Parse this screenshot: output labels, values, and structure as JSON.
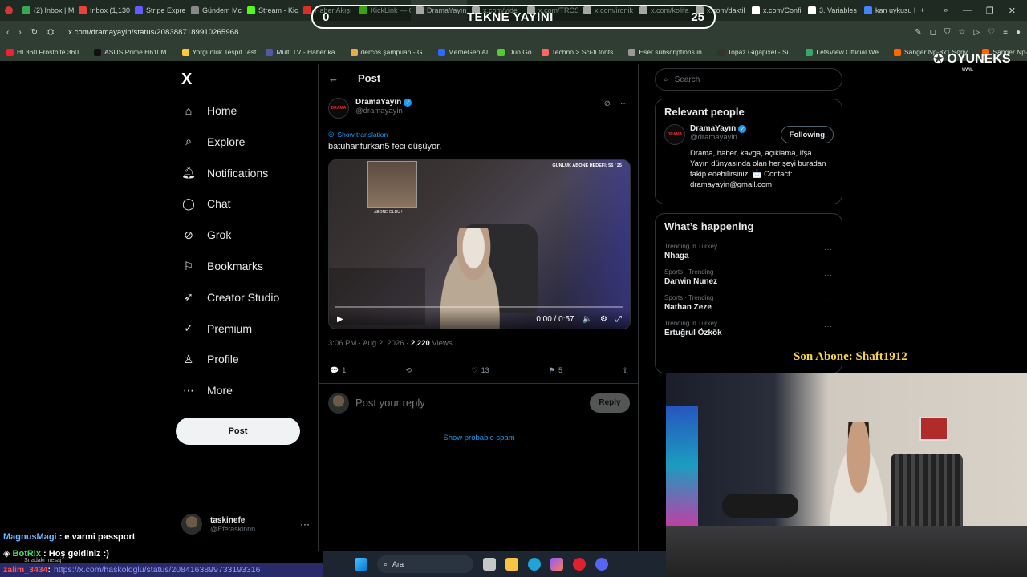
{
  "browser": {
    "tabs": [
      {
        "label": "(2) Inbox | M",
        "color": "#3aa757"
      },
      {
        "label": "Inbox (1,130",
        "color": "#ea4335"
      },
      {
        "label": "Stripe Expre",
        "color": "#635bff"
      },
      {
        "label": "Gündem Mc",
        "color": "#888888"
      },
      {
        "label": "Stream - Kick",
        "color": "#53fc18"
      },
      {
        "label": "Haber Akışı",
        "color": "#d93025"
      },
      {
        "label": "KickLink — C",
        "color": "#53fc18"
      },
      {
        "label": "DramaYayın on X: \"b",
        "color": "#ffffff",
        "active": true
      },
      {
        "label": "x.com/vide",
        "color": "#ffffff"
      },
      {
        "label": "x.com/TRCSI",
        "color": "#ffffff"
      },
      {
        "label": "x.com/ironik",
        "color": "#ffffff"
      },
      {
        "label": "x.com/kolifa",
        "color": "#ffffff"
      },
      {
        "label": "x.com/daktil",
        "color": "#ffffff"
      },
      {
        "label": "x.com/Confi",
        "color": "#ffffff"
      },
      {
        "label": "3. Variables",
        "color": "#ffffff"
      },
      {
        "label": "kan uykusu l",
        "color": "#4285f4"
      }
    ],
    "url": "x.com/dramayayin/status/2083887189910265968",
    "bookmarks": [
      "HL360 Frostbite 360...",
      "ASUS Prime H610M...",
      "Yorgunluk Tespit Test",
      "Multi TV - Haber ka...",
      "dercos şampuan - G...",
      "MemeGen AI",
      "Duo Go",
      "Techno > Sci-fi fonts...",
      "Eser subscriptions in...",
      "Topaz Gigapixel - Su...",
      "LetsView Official We...",
      "Sanger Np-8x1 Sony...",
      "Sanger Np-8x1 Son..."
    ]
  },
  "overlay": {
    "left_count": "0",
    "title": "TEKNE YAYINI",
    "right_count": "25",
    "brand": "OYUNEKS",
    "brand_sub": "www.",
    "son_abone": "Son Abone: Shaft1912"
  },
  "sidebar": {
    "logo": "X",
    "items": [
      {
        "label": "Home",
        "icon": "home-icon"
      },
      {
        "label": "Explore",
        "icon": "search-icon"
      },
      {
        "label": "Notifications",
        "icon": "bell-icon"
      },
      {
        "label": "Chat",
        "icon": "chat-icon"
      },
      {
        "label": "Grok",
        "icon": "grok-icon"
      },
      {
        "label": "Bookmarks",
        "icon": "bookmark-icon"
      },
      {
        "label": "Creator Studio",
        "icon": "rocket-icon"
      },
      {
        "label": "Premium",
        "icon": "verified-icon"
      },
      {
        "label": "Profile",
        "icon": "person-icon"
      },
      {
        "label": "More",
        "icon": "more-circle-icon"
      }
    ],
    "post_label": "Post",
    "account": {
      "name": "taskinefe",
      "handle": "@Efetaskinnn"
    }
  },
  "main": {
    "header": "Post",
    "tweet": {
      "name": "DramaYayın",
      "handle": "@dramayayin",
      "translate": "Show translation",
      "text": "batuhanfurkan5 feci düşüyor.",
      "video_goal": "GÜNLÜK ABONE HEDEFİ: 55 / 25",
      "video_sub": "ABONE OLDU !",
      "video_time": "0:00 / 0:57",
      "time": "3:06 PM · Aug 2, 2026 · ",
      "views_count": "2,220",
      "views_label": " Views",
      "replies": "1",
      "likes": "13",
      "bookmarks": "5"
    },
    "reply_placeholder": "Post your reply",
    "reply_button": "Reply",
    "spam": "Show probable spam"
  },
  "right": {
    "search_placeholder": "Search",
    "relevant_title": "Relevant people",
    "person": {
      "name": "DramaYayın",
      "handle": "@dramayayin",
      "follow": "Following",
      "bio": "Drama, haber, kavga, açıklama, ifşa... Yayın dünyasında olan her şeyi buradan takip edebilirsiniz. 📩 Contact: dramayayin@gmail.com"
    },
    "happening_title": "What’s happening",
    "trends": [
      {
        "cat": "Trending in Turkey",
        "name": "Nhaga"
      },
      {
        "cat": "Sports · Trending",
        "name": "Darwin Nunez"
      },
      {
        "cat": "Sports · Trending",
        "name": "Nathan Zeze"
      },
      {
        "cat": "Trending in Turkey",
        "name": "Ertuğrul Özkök"
      }
    ]
  },
  "chat": {
    "msg1_user": "MagnusMagi",
    "msg1_text": ": e varmi passport",
    "msg2_user": "BotRix",
    "msg2_text": ": Hoş geldiniz :)",
    "msg2_sub": "Sıradaki mesaj",
    "msg3_user": "zalim_3434",
    "msg3_link": "https://x.com/haskologlu/status/2084163899733193316"
  },
  "taskbar": {
    "search": "Ara"
  }
}
